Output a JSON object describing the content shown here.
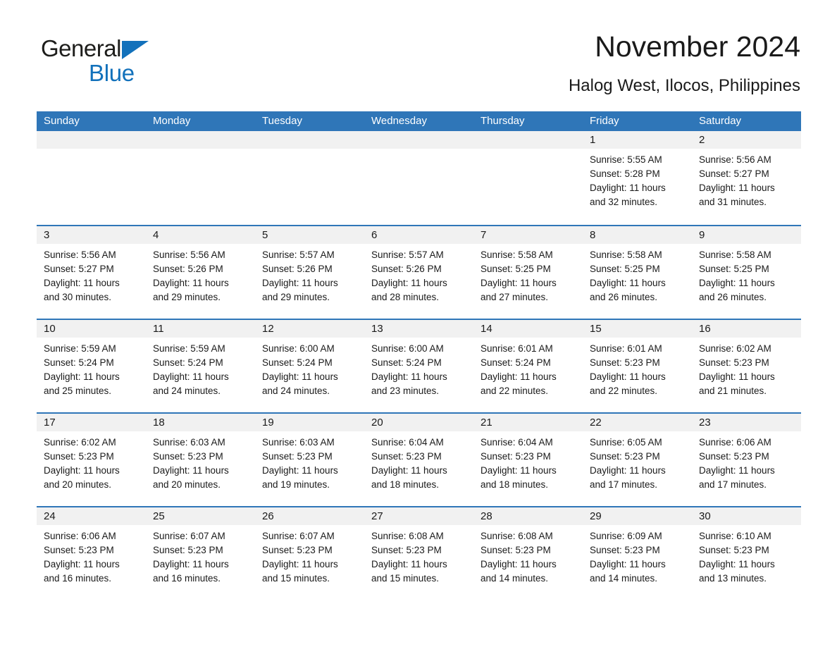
{
  "brand": {
    "name_part1": "General",
    "name_part2": "Blue",
    "triangle_icon": "triangle-icon",
    "accent_color": "#1271bb"
  },
  "header": {
    "title": "November 2024",
    "subtitle": "Halog West, Ilocos, Philippines"
  },
  "calendar": {
    "header_bg": "#2f76b8",
    "row_divider_color": "#2f76b8",
    "daynum_band_bg": "#f1f1f1",
    "weekdays": [
      "Sunday",
      "Monday",
      "Tuesday",
      "Wednesday",
      "Thursday",
      "Friday",
      "Saturday"
    ],
    "weeks": [
      [
        {
          "day": "",
          "sunrise": "",
          "sunset": "",
          "daylight_line1": "",
          "daylight_line2": ""
        },
        {
          "day": "",
          "sunrise": "",
          "sunset": "",
          "daylight_line1": "",
          "daylight_line2": ""
        },
        {
          "day": "",
          "sunrise": "",
          "sunset": "",
          "daylight_line1": "",
          "daylight_line2": ""
        },
        {
          "day": "",
          "sunrise": "",
          "sunset": "",
          "daylight_line1": "",
          "daylight_line2": ""
        },
        {
          "day": "",
          "sunrise": "",
          "sunset": "",
          "daylight_line1": "",
          "daylight_line2": ""
        },
        {
          "day": "1",
          "sunrise": "Sunrise: 5:55 AM",
          "sunset": "Sunset: 5:28 PM",
          "daylight_line1": "Daylight: 11 hours",
          "daylight_line2": "and 32 minutes."
        },
        {
          "day": "2",
          "sunrise": "Sunrise: 5:56 AM",
          "sunset": "Sunset: 5:27 PM",
          "daylight_line1": "Daylight: 11 hours",
          "daylight_line2": "and 31 minutes."
        }
      ],
      [
        {
          "day": "3",
          "sunrise": "Sunrise: 5:56 AM",
          "sunset": "Sunset: 5:27 PM",
          "daylight_line1": "Daylight: 11 hours",
          "daylight_line2": "and 30 minutes."
        },
        {
          "day": "4",
          "sunrise": "Sunrise: 5:56 AM",
          "sunset": "Sunset: 5:26 PM",
          "daylight_line1": "Daylight: 11 hours",
          "daylight_line2": "and 29 minutes."
        },
        {
          "day": "5",
          "sunrise": "Sunrise: 5:57 AM",
          "sunset": "Sunset: 5:26 PM",
          "daylight_line1": "Daylight: 11 hours",
          "daylight_line2": "and 29 minutes."
        },
        {
          "day": "6",
          "sunrise": "Sunrise: 5:57 AM",
          "sunset": "Sunset: 5:26 PM",
          "daylight_line1": "Daylight: 11 hours",
          "daylight_line2": "and 28 minutes."
        },
        {
          "day": "7",
          "sunrise": "Sunrise: 5:58 AM",
          "sunset": "Sunset: 5:25 PM",
          "daylight_line1": "Daylight: 11 hours",
          "daylight_line2": "and 27 minutes."
        },
        {
          "day": "8",
          "sunrise": "Sunrise: 5:58 AM",
          "sunset": "Sunset: 5:25 PM",
          "daylight_line1": "Daylight: 11 hours",
          "daylight_line2": "and 26 minutes."
        },
        {
          "day": "9",
          "sunrise": "Sunrise: 5:58 AM",
          "sunset": "Sunset: 5:25 PM",
          "daylight_line1": "Daylight: 11 hours",
          "daylight_line2": "and 26 minutes."
        }
      ],
      [
        {
          "day": "10",
          "sunrise": "Sunrise: 5:59 AM",
          "sunset": "Sunset: 5:24 PM",
          "daylight_line1": "Daylight: 11 hours",
          "daylight_line2": "and 25 minutes."
        },
        {
          "day": "11",
          "sunrise": "Sunrise: 5:59 AM",
          "sunset": "Sunset: 5:24 PM",
          "daylight_line1": "Daylight: 11 hours",
          "daylight_line2": "and 24 minutes."
        },
        {
          "day": "12",
          "sunrise": "Sunrise: 6:00 AM",
          "sunset": "Sunset: 5:24 PM",
          "daylight_line1": "Daylight: 11 hours",
          "daylight_line2": "and 24 minutes."
        },
        {
          "day": "13",
          "sunrise": "Sunrise: 6:00 AM",
          "sunset": "Sunset: 5:24 PM",
          "daylight_line1": "Daylight: 11 hours",
          "daylight_line2": "and 23 minutes."
        },
        {
          "day": "14",
          "sunrise": "Sunrise: 6:01 AM",
          "sunset": "Sunset: 5:24 PM",
          "daylight_line1": "Daylight: 11 hours",
          "daylight_line2": "and 22 minutes."
        },
        {
          "day": "15",
          "sunrise": "Sunrise: 6:01 AM",
          "sunset": "Sunset: 5:23 PM",
          "daylight_line1": "Daylight: 11 hours",
          "daylight_line2": "and 22 minutes."
        },
        {
          "day": "16",
          "sunrise": "Sunrise: 6:02 AM",
          "sunset": "Sunset: 5:23 PM",
          "daylight_line1": "Daylight: 11 hours",
          "daylight_line2": "and 21 minutes."
        }
      ],
      [
        {
          "day": "17",
          "sunrise": "Sunrise: 6:02 AM",
          "sunset": "Sunset: 5:23 PM",
          "daylight_line1": "Daylight: 11 hours",
          "daylight_line2": "and 20 minutes."
        },
        {
          "day": "18",
          "sunrise": "Sunrise: 6:03 AM",
          "sunset": "Sunset: 5:23 PM",
          "daylight_line1": "Daylight: 11 hours",
          "daylight_line2": "and 20 minutes."
        },
        {
          "day": "19",
          "sunrise": "Sunrise: 6:03 AM",
          "sunset": "Sunset: 5:23 PM",
          "daylight_line1": "Daylight: 11 hours",
          "daylight_line2": "and 19 minutes."
        },
        {
          "day": "20",
          "sunrise": "Sunrise: 6:04 AM",
          "sunset": "Sunset: 5:23 PM",
          "daylight_line1": "Daylight: 11 hours",
          "daylight_line2": "and 18 minutes."
        },
        {
          "day": "21",
          "sunrise": "Sunrise: 6:04 AM",
          "sunset": "Sunset: 5:23 PM",
          "daylight_line1": "Daylight: 11 hours",
          "daylight_line2": "and 18 minutes."
        },
        {
          "day": "22",
          "sunrise": "Sunrise: 6:05 AM",
          "sunset": "Sunset: 5:23 PM",
          "daylight_line1": "Daylight: 11 hours",
          "daylight_line2": "and 17 minutes."
        },
        {
          "day": "23",
          "sunrise": "Sunrise: 6:06 AM",
          "sunset": "Sunset: 5:23 PM",
          "daylight_line1": "Daylight: 11 hours",
          "daylight_line2": "and 17 minutes."
        }
      ],
      [
        {
          "day": "24",
          "sunrise": "Sunrise: 6:06 AM",
          "sunset": "Sunset: 5:23 PM",
          "daylight_line1": "Daylight: 11 hours",
          "daylight_line2": "and 16 minutes."
        },
        {
          "day": "25",
          "sunrise": "Sunrise: 6:07 AM",
          "sunset": "Sunset: 5:23 PM",
          "daylight_line1": "Daylight: 11 hours",
          "daylight_line2": "and 16 minutes."
        },
        {
          "day": "26",
          "sunrise": "Sunrise: 6:07 AM",
          "sunset": "Sunset: 5:23 PM",
          "daylight_line1": "Daylight: 11 hours",
          "daylight_line2": "and 15 minutes."
        },
        {
          "day": "27",
          "sunrise": "Sunrise: 6:08 AM",
          "sunset": "Sunset: 5:23 PM",
          "daylight_line1": "Daylight: 11 hours",
          "daylight_line2": "and 15 minutes."
        },
        {
          "day": "28",
          "sunrise": "Sunrise: 6:08 AM",
          "sunset": "Sunset: 5:23 PM",
          "daylight_line1": "Daylight: 11 hours",
          "daylight_line2": "and 14 minutes."
        },
        {
          "day": "29",
          "sunrise": "Sunrise: 6:09 AM",
          "sunset": "Sunset: 5:23 PM",
          "daylight_line1": "Daylight: 11 hours",
          "daylight_line2": "and 14 minutes."
        },
        {
          "day": "30",
          "sunrise": "Sunrise: 6:10 AM",
          "sunset": "Sunset: 5:23 PM",
          "daylight_line1": "Daylight: 11 hours",
          "daylight_line2": "and 13 minutes."
        }
      ]
    ]
  }
}
